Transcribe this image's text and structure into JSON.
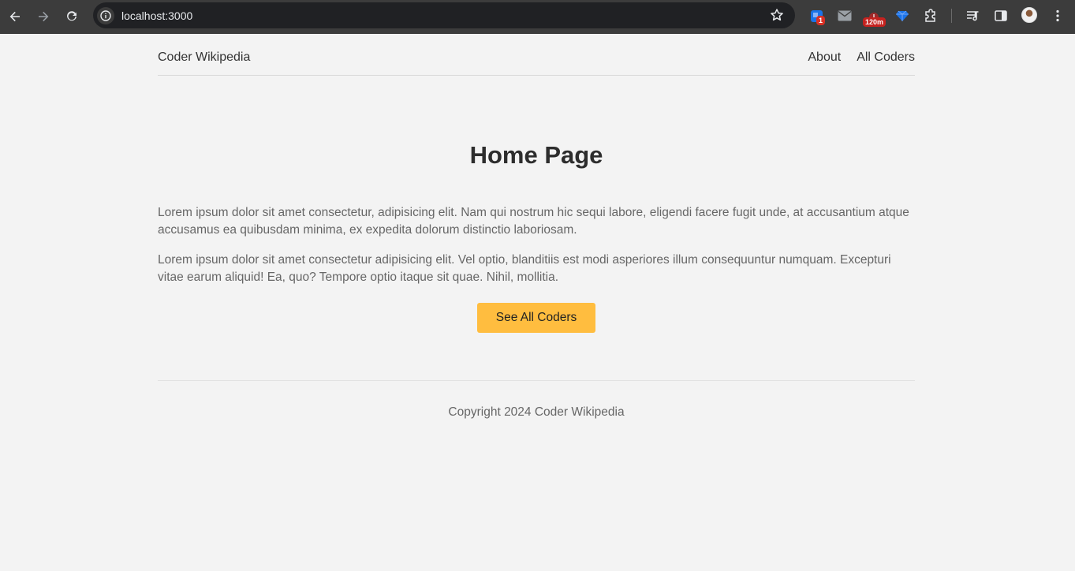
{
  "browser": {
    "url": "localhost:3000",
    "extensions": [
      {
        "name": "blue-extension-icon",
        "badge": "1"
      },
      {
        "name": "mail-extension-icon"
      },
      {
        "name": "timer-extension-icon",
        "badge": "120m"
      },
      {
        "name": "gem-extension-icon"
      },
      {
        "name": "puzzle-extensions-icon"
      }
    ],
    "colors": {
      "chrome": "#3c3c3c",
      "omnibox": "#202124",
      "badge": "#d93025"
    }
  },
  "site": {
    "brand": "Coder Wikipedia",
    "nav": [
      {
        "label": "About"
      },
      {
        "label": "All Coders"
      }
    ]
  },
  "main": {
    "title": "Home Page",
    "paragraphs": [
      "Lorem ipsum dolor sit amet consectetur, adipisicing elit. Nam qui nostrum hic sequi labore, eligendi facere fugit unde, at accusantium atque accusamus ea quibusdam minima, ex expedita dolorum distinctio laboriosam.",
      "Lorem ipsum dolor sit amet consectetur adipisicing elit. Vel optio, blanditiis est modi asperiores illum consequuntur numquam. Excepturi vitae earum aliquid! Ea, quo? Tempore optio itaque sit quae. Nihil, mollitia."
    ],
    "cta_label": "See All Coders"
  },
  "footer": {
    "copyright": "Copyright 2024 Coder Wikipedia"
  },
  "colors": {
    "page_bg": "#f3f3f3",
    "accent": "#ffbd3f",
    "text": "#333333",
    "muted_text": "#666666"
  }
}
